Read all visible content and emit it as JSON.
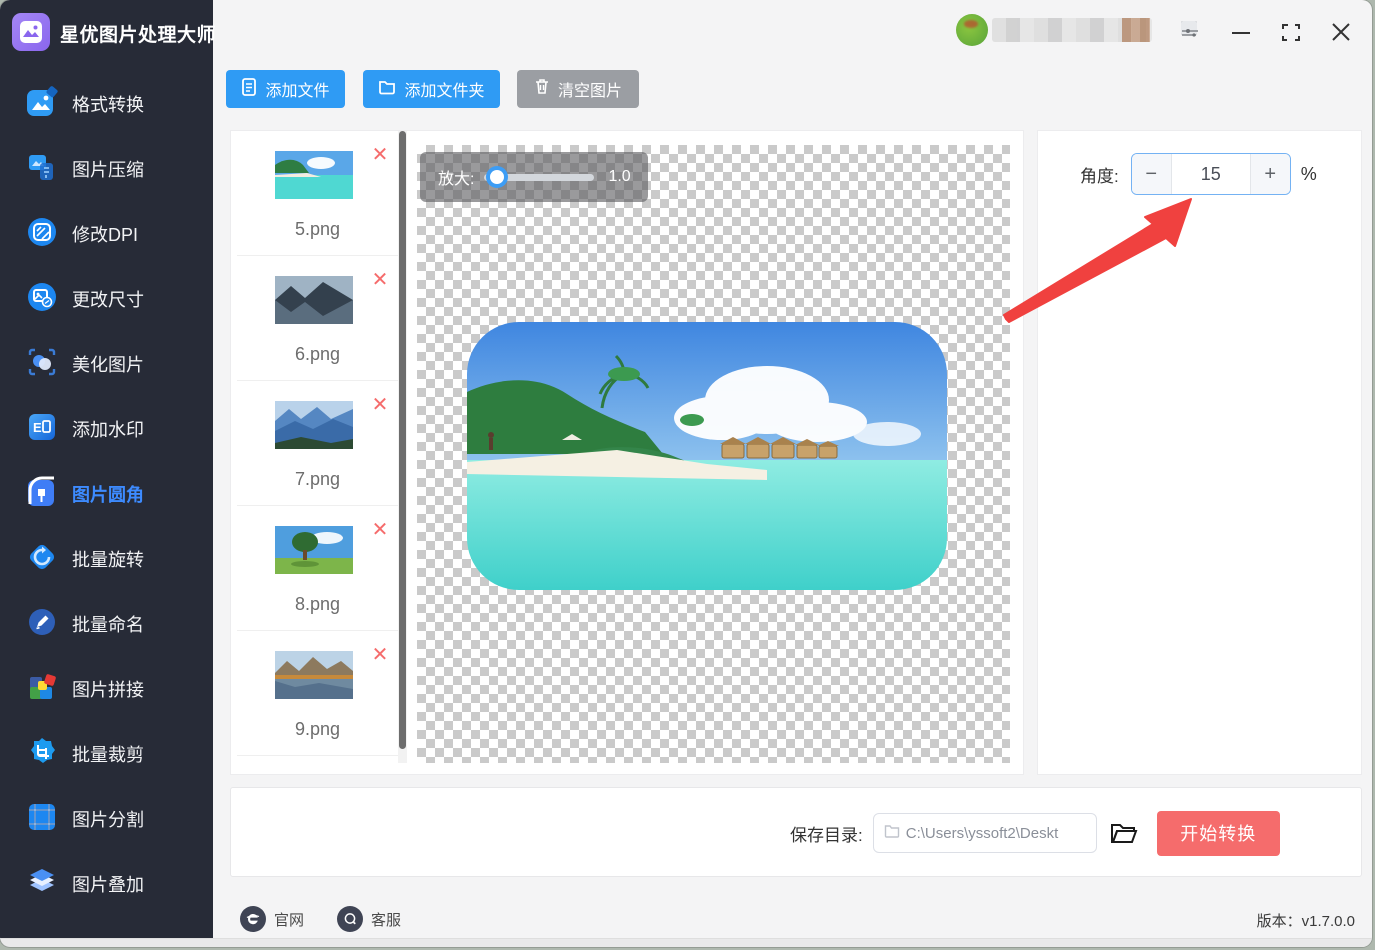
{
  "app": {
    "title": "星优图片处理大师"
  },
  "sidebar": {
    "items": [
      {
        "label": "格式转换"
      },
      {
        "label": "图片压缩"
      },
      {
        "label": "修改DPI"
      },
      {
        "label": "更改尺寸"
      },
      {
        "label": "美化图片"
      },
      {
        "label": "添加水印"
      },
      {
        "label": "图片圆角"
      },
      {
        "label": "批量旋转"
      },
      {
        "label": "批量命名"
      },
      {
        "label": "图片拼接"
      },
      {
        "label": "批量裁剪"
      },
      {
        "label": "图片分割"
      },
      {
        "label": "图片叠加"
      }
    ],
    "active_label": "图片圆角"
  },
  "toolbar": {
    "add_file": "添加文件",
    "add_folder": "添加文件夹",
    "clear_images": "清空图片"
  },
  "filelist": {
    "items": [
      {
        "name": "5.png"
      },
      {
        "name": "6.png"
      },
      {
        "name": "7.png"
      },
      {
        "name": "8.png"
      },
      {
        "name": "9.png"
      }
    ],
    "delete_glyph": "✕"
  },
  "preview": {
    "zoom_label": "放大:",
    "zoom_value": "1.0"
  },
  "panel": {
    "angle_label": "角度:",
    "angle_value": "15",
    "minus": "−",
    "plus": "+",
    "unit": "%"
  },
  "bottom": {
    "save_dir_label": "保存目录:",
    "save_dir_value": "C:\\Users\\yssoft2\\Deskt",
    "start_button": "开始转换"
  },
  "footer": {
    "website": "官网",
    "support": "客服",
    "version": "版本：v1.7.0.0"
  },
  "colors": {
    "sidebar_bg": "#272b37",
    "accent_blue": "#2f9bf4",
    "active_menu": "#3d8bff",
    "danger_red": "#f56c6c",
    "gray_button": "#9b9ea3",
    "stepper_border": "#74b2f3",
    "arrow_red": "#f0413f"
  }
}
